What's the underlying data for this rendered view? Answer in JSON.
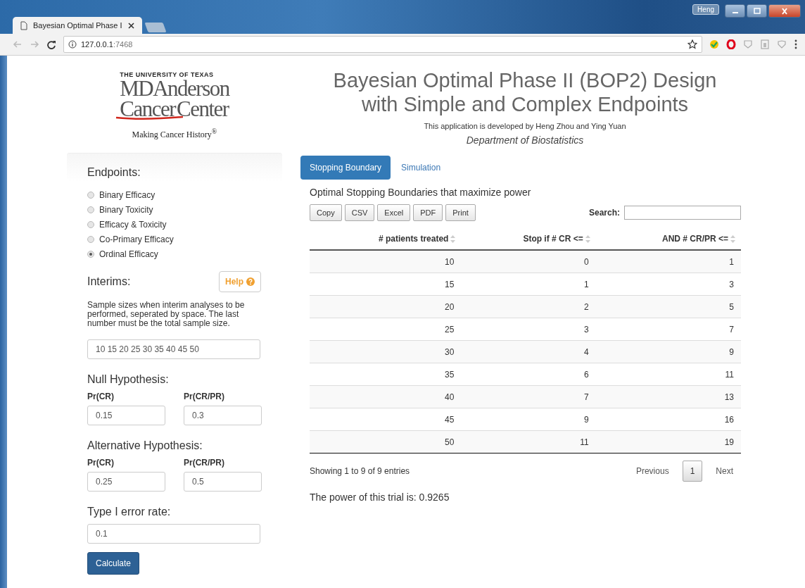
{
  "browser": {
    "user": "Heng",
    "tab_title": "Bayesian Optimal Phase I",
    "address_host": "127.0.0.1",
    "address_port": ":7468"
  },
  "logo": {
    "line_1": "THE UNIVERSITY OF TEXAS",
    "line_2": "MDAnderson",
    "line_3a": "Cancer",
    "line_3b": "Center",
    "tagline": "Making Cancer History$^{®}$"
  },
  "sidebar": {
    "endpoints_label": "Endpoints:",
    "endpoints": [
      {
        "label": "Binary Efficacy",
        "selected": false
      },
      {
        "label": "Binary Toxicity",
        "selected": false
      },
      {
        "label": "Efficacy & Toxicity",
        "selected": false
      },
      {
        "label": "Co-Primary Efficacy",
        "selected": false
      },
      {
        "label": "Ordinal Efficacy",
        "selected": true
      }
    ],
    "interims_label": "Interims:",
    "help_button": "Help",
    "interims_hint": "Sample sizes when interim analyses to be performed, seperated by space. The last number must be the total sample size.",
    "interims_value": "10 15 20 25 30 35 40 45 50",
    "null_label": "Null Hypothesis:",
    "null_fields": [
      {
        "label": "Pr(CR)",
        "value": "0.15"
      },
      {
        "label": "Pr(CR/PR)",
        "value": "0.3"
      }
    ],
    "alt_label": "Alternative Hypothesis:",
    "alt_fields": [
      {
        "label": "Pr(CR)",
        "value": "0.25"
      },
      {
        "label": "Pr(CR/PR)",
        "value": "0.5"
      }
    ],
    "error_label": "Type I error rate:",
    "error_value": "0.1",
    "calculate_button": "Calculate"
  },
  "header": {
    "title_1": "Bayesian Optimal Phase II (BOP2) Design",
    "title_2": "with Simple and Complex Endpoints",
    "subtitle": "This application is developed by Heng Zhou and Ying Yuan",
    "department": "Department of Biostatistics"
  },
  "tabs": [
    {
      "label": "Stopping Boundary",
      "selected": true
    },
    {
      "label": "Simulation",
      "selected": false
    }
  ],
  "table": {
    "title": "Optimal Stopping Boundaries that maximize power",
    "export_buttons": [
      "Copy",
      "CSV",
      "Excel",
      "PDF",
      "Print"
    ],
    "search_label": "Search:",
    "columns": [
      "# patients treated",
      "Stop if # CR <=",
      "AND # CR/PR <="
    ],
    "rows": [
      [
        "10",
        "0",
        "1"
      ],
      [
        "15",
        "1",
        "3"
      ],
      [
        "20",
        "2",
        "5"
      ],
      [
        "25",
        "3",
        "7"
      ],
      [
        "30",
        "4",
        "9"
      ],
      [
        "35",
        "6",
        "11"
      ],
      [
        "40",
        "7",
        "13"
      ],
      [
        "45",
        "9",
        "16"
      ],
      [
        "50",
        "11",
        "19"
      ]
    ],
    "info": "Showing 1 to 9 of 9 entries",
    "pagination": {
      "previous": "Previous",
      "pages": [
        {
          "label": "1",
          "selected": true
        }
      ],
      "next": "Next"
    }
  },
  "power": "The power of this trial is: 0.9265"
}
